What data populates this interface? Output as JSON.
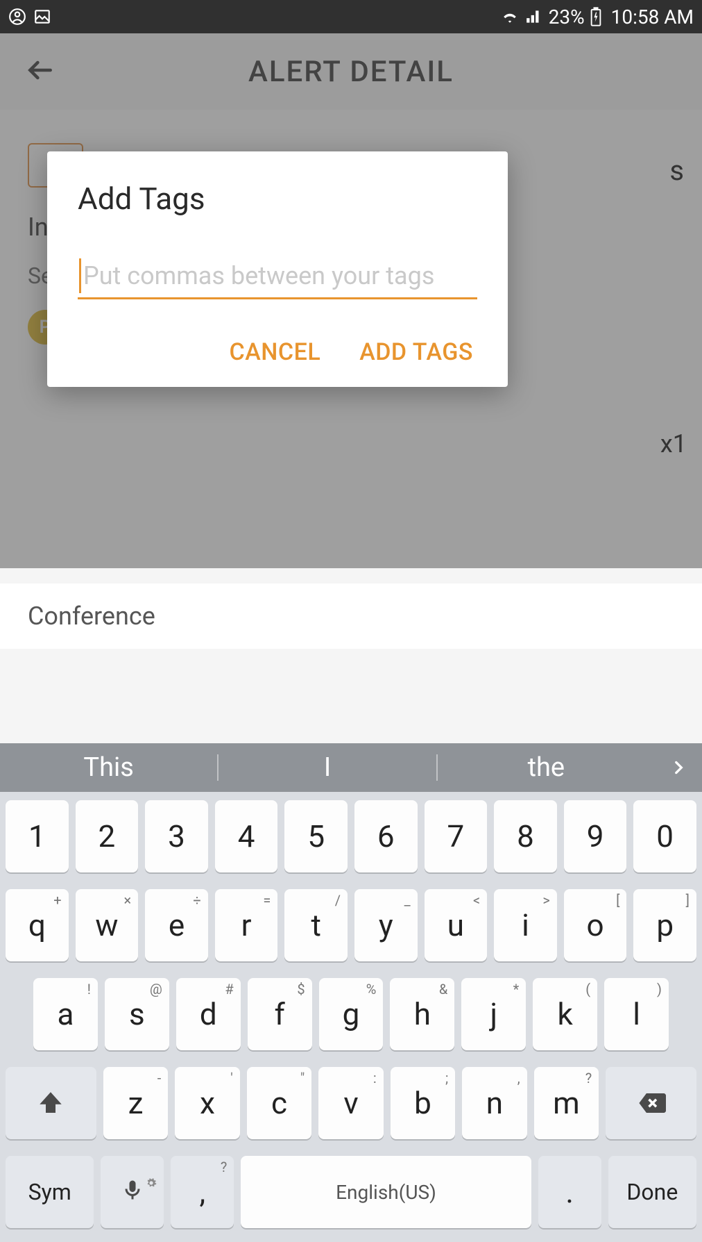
{
  "status_bar": {
    "battery_pct": "23%",
    "time": "10:58 AM"
  },
  "header": {
    "title": "ALERT DETAIL"
  },
  "background": {
    "line_in": "In",
    "line_se": "Se",
    "badge_p": "P",
    "side_s": "s",
    "side_x1": "x1",
    "section2": "Conference"
  },
  "dialog": {
    "title": "Add Tags",
    "placeholder": "Put commas between your tags",
    "value": "",
    "cancel": "CANCEL",
    "confirm": "ADD TAGS"
  },
  "keyboard": {
    "suggestions": [
      "This",
      "I",
      "the"
    ],
    "row_num": [
      "1",
      "2",
      "3",
      "4",
      "5",
      "6",
      "7",
      "8",
      "9",
      "0"
    ],
    "row1": [
      {
        "k": "q",
        "s": "+"
      },
      {
        "k": "w",
        "s": "×"
      },
      {
        "k": "e",
        "s": "÷"
      },
      {
        "k": "r",
        "s": "="
      },
      {
        "k": "t",
        "s": "/"
      },
      {
        "k": "y",
        "s": "_"
      },
      {
        "k": "u",
        "s": "<"
      },
      {
        "k": "i",
        "s": ">"
      },
      {
        "k": "o",
        "s": "["
      },
      {
        "k": "p",
        "s": "]"
      }
    ],
    "row2": [
      {
        "k": "a",
        "s": "!"
      },
      {
        "k": "s",
        "s": "@"
      },
      {
        "k": "d",
        "s": "#"
      },
      {
        "k": "f",
        "s": "$"
      },
      {
        "k": "g",
        "s": "%"
      },
      {
        "k": "h",
        "s": "&"
      },
      {
        "k": "j",
        "s": "*"
      },
      {
        "k": "k",
        "s": "("
      },
      {
        "k": "l",
        "s": ")"
      }
    ],
    "row3": [
      {
        "k": "z",
        "s": "-"
      },
      {
        "k": "x",
        "s": "'"
      },
      {
        "k": "c",
        "s": "\""
      },
      {
        "k": "v",
        "s": ":"
      },
      {
        "k": "b",
        "s": ";"
      },
      {
        "k": "n",
        "s": ","
      },
      {
        "k": "m",
        "s": "?"
      }
    ],
    "sym": "Sym",
    "comma": ",",
    "comma_sup": "?",
    "space_label": "English(US)",
    "period": ".",
    "done": "Done"
  }
}
